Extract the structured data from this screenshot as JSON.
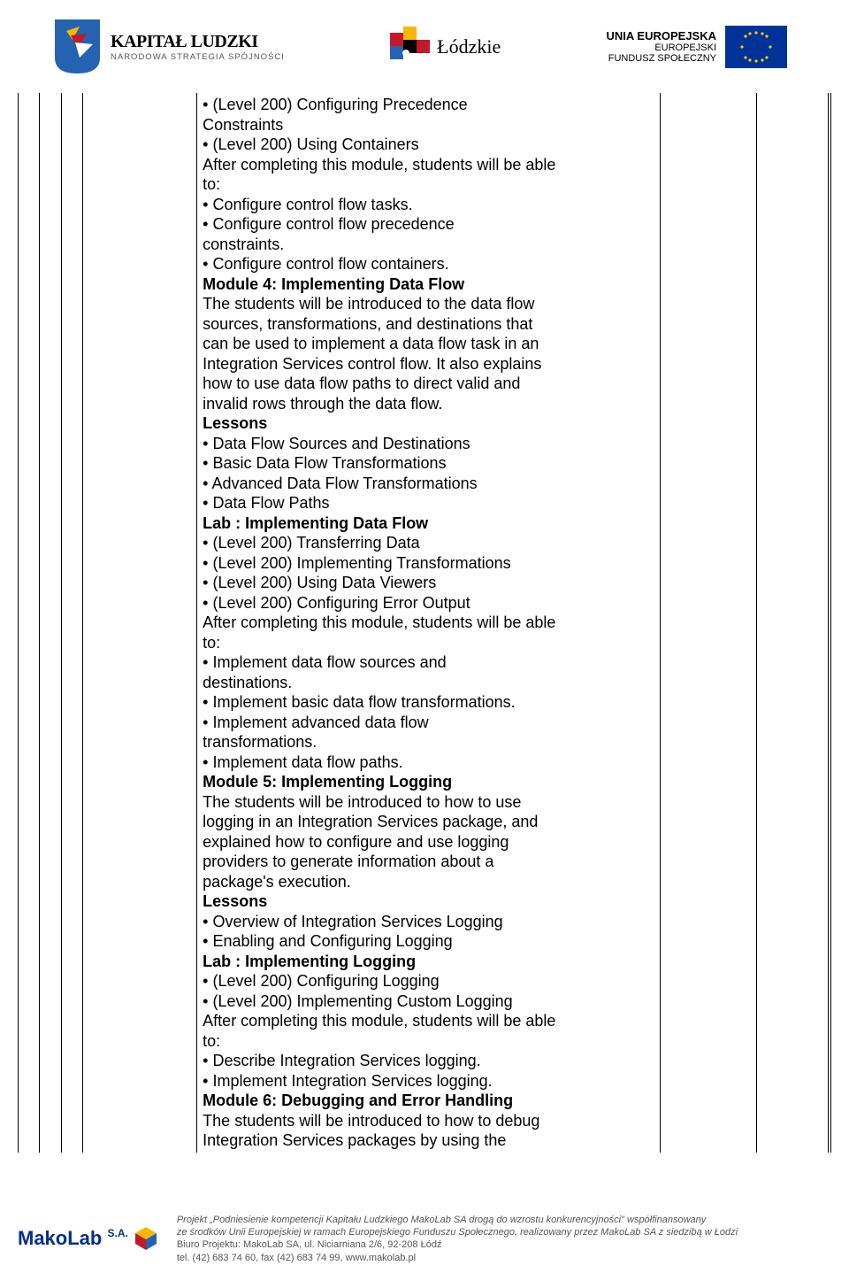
{
  "header": {
    "kapital_title": "KAPITAŁ LUDZKI",
    "kapital_sub": "NARODOWA STRATEGIA SPÓJNOŚCI",
    "lodzkie": "Łódzkie",
    "eu_line1": "UNIA EUROPEJSKA",
    "eu_line2": "EUROPEJSKI",
    "eu_line3": "FUNDUSZ SPOŁECZNY"
  },
  "content": {
    "l0": "• (Level 200) Configuring Precedence",
    "l1": "Constraints",
    "l2": "• (Level 200) Using Containers",
    "l3": "After completing this module, students will be able",
    "l4": "to:",
    "l5": "• Configure control flow tasks.",
    "l6": "• Configure control flow precedence",
    "l7": "constraints.",
    "l8": "• Configure control flow containers.",
    "m4_title": "Module 4: Implementing Data Flow",
    "m4_1": "The students will be introduced to the data flow",
    "m4_2": "sources, transformations, and destinations that",
    "m4_3": "can be used to implement a data flow task in an",
    "m4_4": "Integration Services control flow. It also explains",
    "m4_5": "how to use data flow paths to direct valid and",
    "m4_6": "invalid rows through the data flow.",
    "lessons": "Lessons",
    "m4_l1": "• Data Flow Sources and Destinations",
    "m4_l2": "• Basic Data Flow Transformations",
    "m4_l3": "• Advanced Data Flow Transformations",
    "m4_l4": "• Data Flow Paths",
    "m4_lab": "Lab : Implementing Data Flow",
    "m4_lab1": "• (Level 200) Transferring Data",
    "m4_lab2": "• (Level 200) Implementing Transformations",
    "m4_lab3": "• (Level 200) Using Data Viewers",
    "m4_lab4": "• (Level 200) Configuring Error Output",
    "m4_after": "After completing this module, students will be able",
    "m4_to": "to:",
    "m4_a1": "• Implement data flow sources and",
    "m4_a1b": "destinations.",
    "m4_a2": "• Implement basic data flow transformations.",
    "m4_a3": "• Implement advanced data flow",
    "m4_a3b": "transformations.",
    "m4_a4": "• Implement data flow paths.",
    "m5_title": "Module 5: Implementing Logging",
    "m5_1": "The students will be introduced to how to use",
    "m5_2": "logging in an Integration Services package, and",
    "m5_3": "explained how to configure and use logging",
    "m5_4": "providers to generate information about a",
    "m5_5": "package's execution.",
    "m5_l1": "• Overview of Integration Services Logging",
    "m5_l2": "• Enabling and Configuring Logging",
    "m5_lab": "Lab : Implementing Logging",
    "m5_lab1": "• (Level 200) Configuring Logging",
    "m5_lab2": "• (Level 200) Implementing Custom Logging",
    "m5_after": "After completing this module, students will be able",
    "m5_to": "to:",
    "m5_a1": "• Describe Integration Services logging.",
    "m5_a2": "• Implement Integration Services logging.",
    "m6_title": "Module 6: Debugging and Error Handling",
    "m6_1": "The students will be introduced to how to debug",
    "m6_2": "Integration Services packages by using the"
  },
  "footer": {
    "brand": "MakoLab",
    "brand_suffix": "S.A.",
    "f1": "Projekt „Podniesienie kompetencji Kapitału Ludzkiego MakoLab SA drogą do wzrostu konkurencyjności\" współfinansowany",
    "f2": "ze środków Unii Europejskiej w ramach Europejskiego Funduszu Społecznego, realizowany przez MakoLab SA z siedzibą w Łodzi",
    "f3": "Biuro Projektu: MakoLab SA, ul. Niciarniana 2/6, 92-208 Łódź",
    "f4": "tel. (42) 683 74 60, fax (42) 683 74 99, www.makolab.pl"
  }
}
